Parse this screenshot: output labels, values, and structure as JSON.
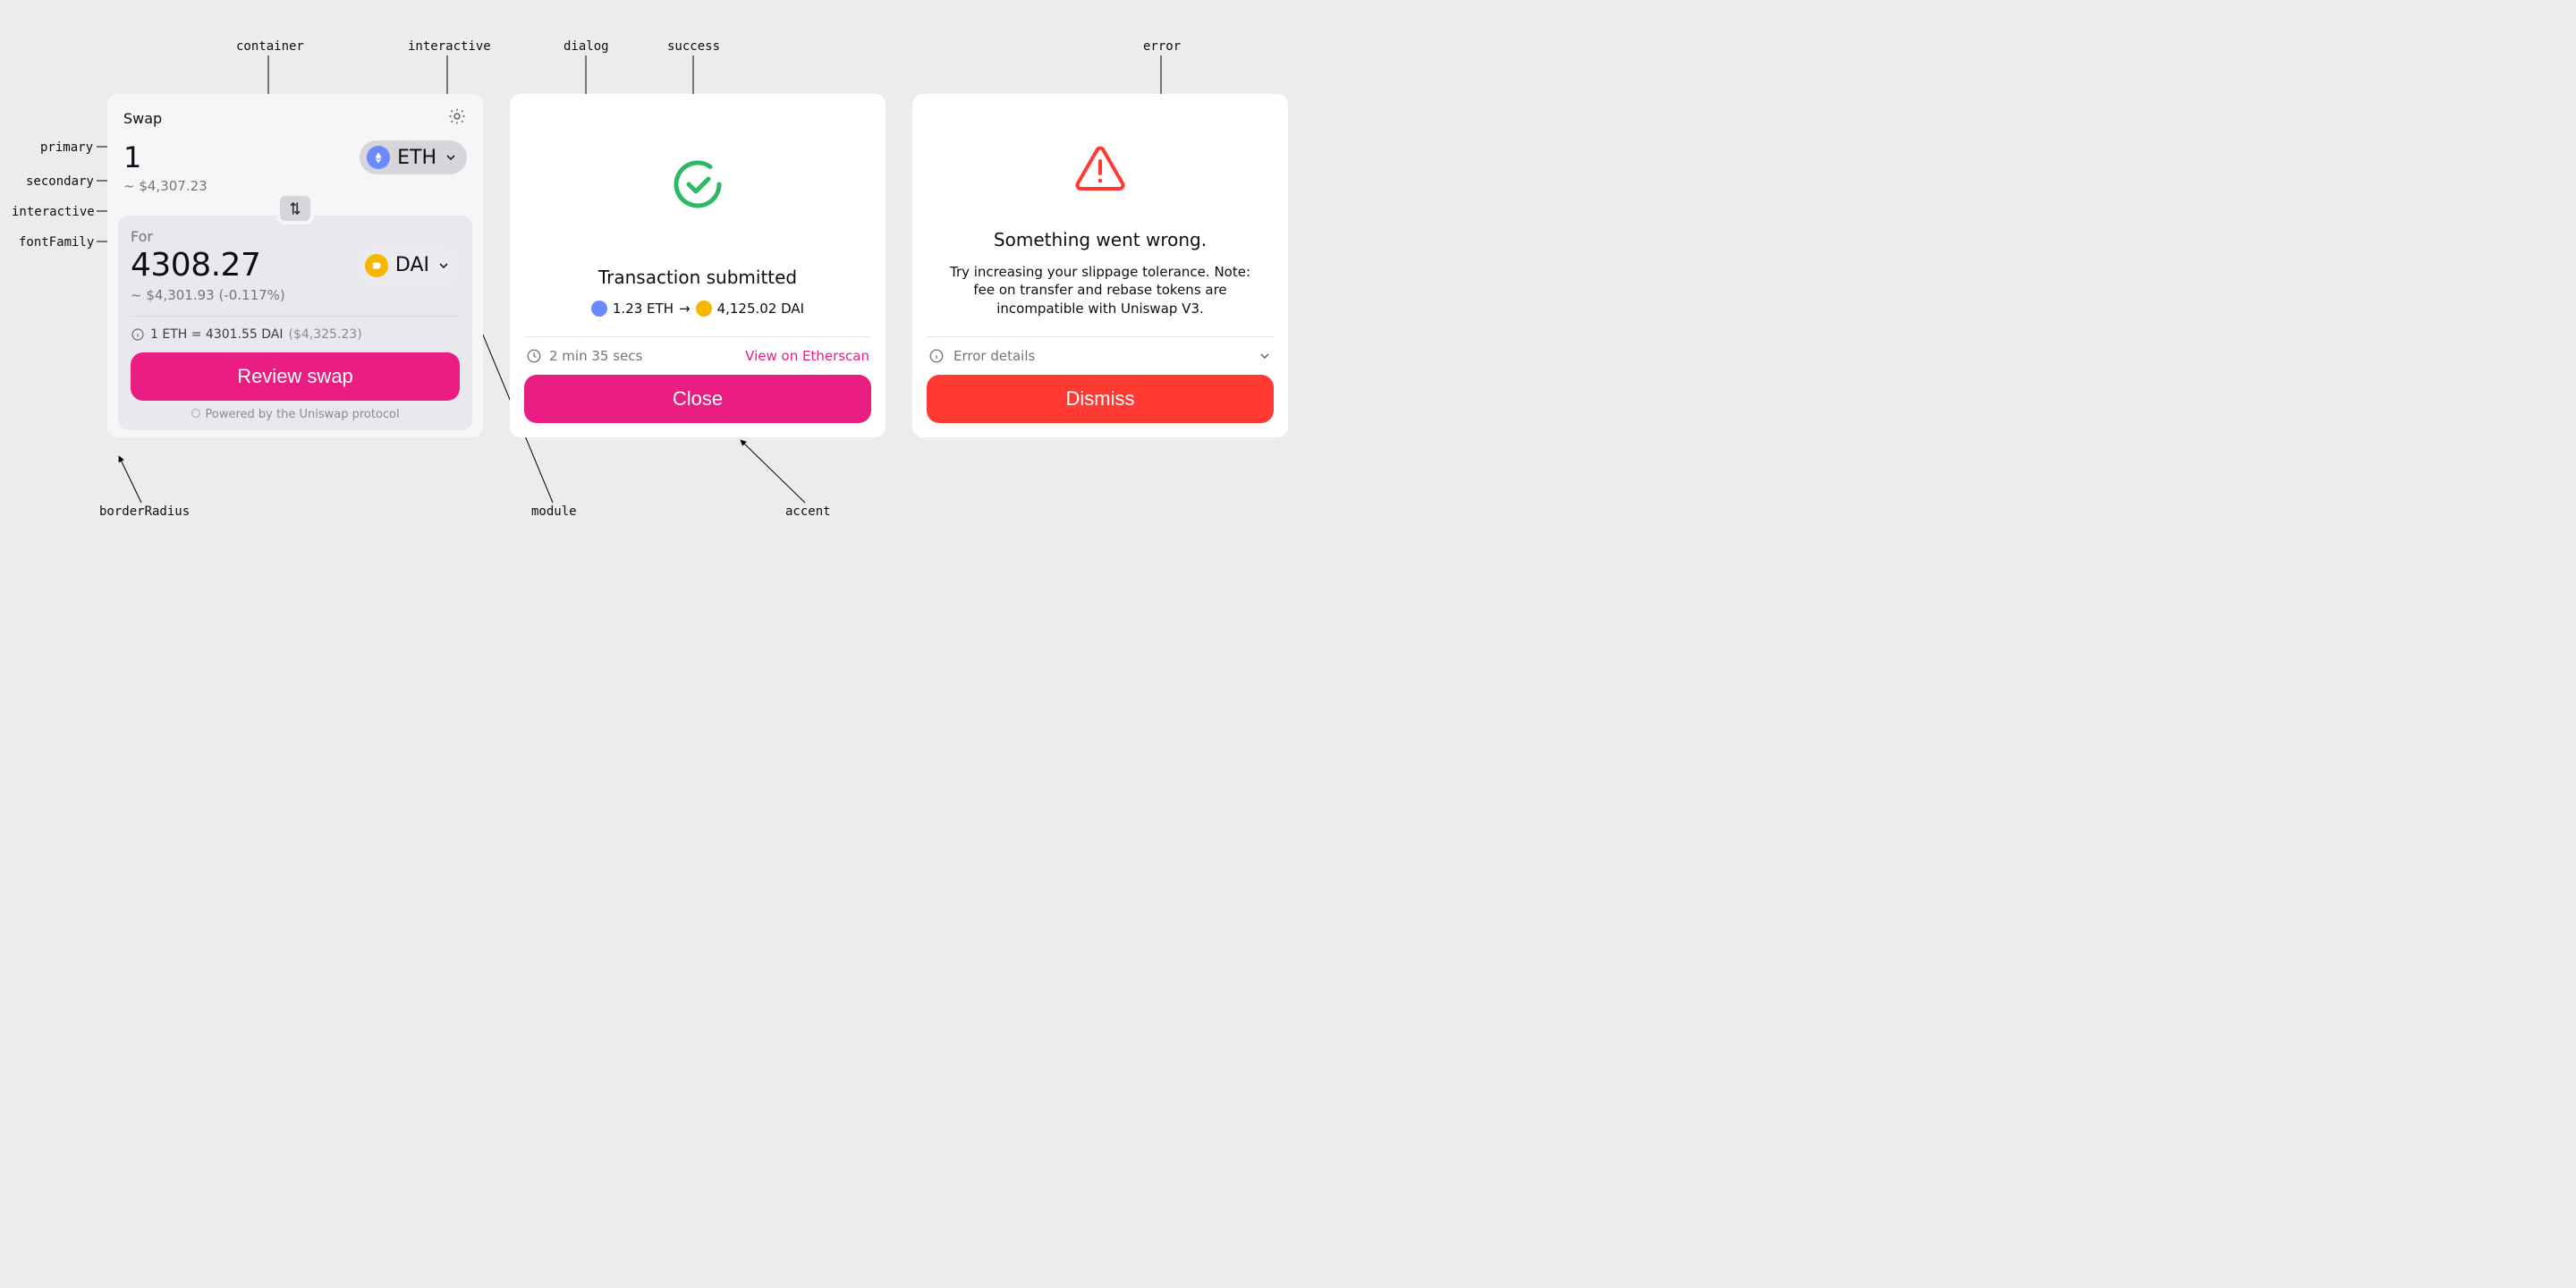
{
  "annotations": {
    "container": "container",
    "interactive_top": "interactive",
    "dialog": "dialog",
    "success": "success",
    "error": "error",
    "primary": "primary",
    "secondary": "secondary",
    "interactive_mid": "interactive",
    "fontFamily": "fontFamily",
    "borderRadius": "borderRadius",
    "module": "module",
    "accent": "accent"
  },
  "swap": {
    "title": "Swap",
    "from_amount": "1",
    "from_fiat": "~ $4,307.23",
    "from_token_symbol": "ETH",
    "for_label": "For",
    "to_amount": "4308.27",
    "to_fiat": "~ $4,301.93 (-0.117%)",
    "to_token_symbol": "DAI",
    "rate_text": "1 ETH = 4301.55 DAI",
    "rate_price": "($4,325.23)",
    "review_label": "Review swap",
    "powered": "Powered by the Uniswap protocol"
  },
  "tx": {
    "title": "Transaction submitted",
    "from_amount": "1.23 ETH",
    "arrow": "→",
    "to_amount": "4,125.02 DAI",
    "elapsed": "2 min 35 secs",
    "view_link": "View on Etherscan",
    "close_label": "Close"
  },
  "err": {
    "title": "Something went wrong.",
    "body": "Try increasing your slippage tolerance. Note: fee on transfer and rebase tokens are incompatible with Uniswap V3.",
    "details_label": "Error details",
    "dismiss_label": "Dismiss"
  },
  "colors": {
    "accent": "#ea1d82",
    "error": "#ff3a33",
    "success": "#2db864",
    "module": "#e9e9ed",
    "container": "#f6f6f9",
    "dialog": "#ffffff"
  }
}
